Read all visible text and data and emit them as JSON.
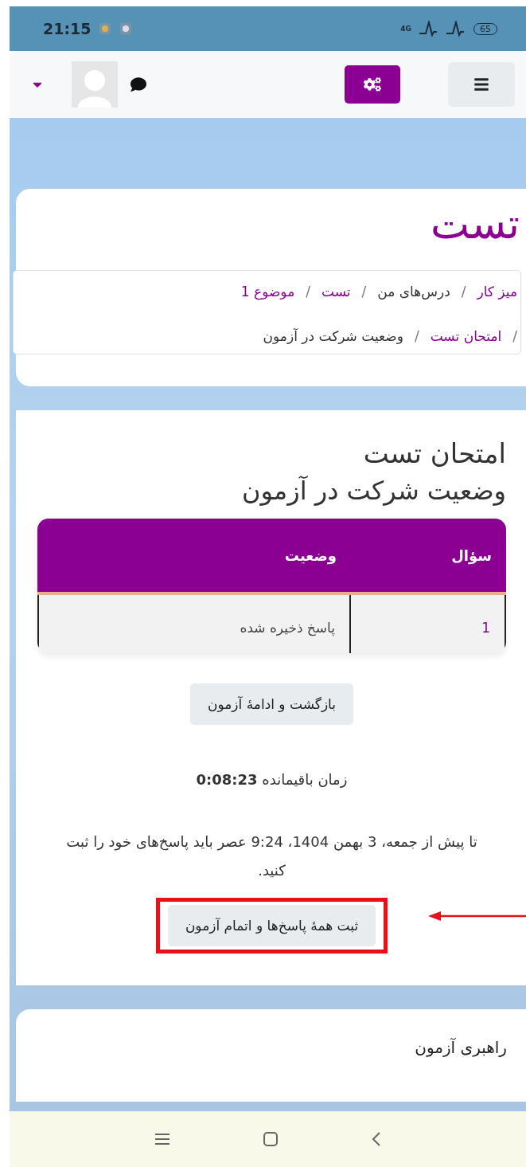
{
  "status_bar": {
    "time": "21:15",
    "network": "4G",
    "battery": "65"
  },
  "navbar": {
    "settings_button": {
      "selected": true
    }
  },
  "page_header": {
    "title": "تست",
    "breadcrumb": [
      {
        "kind": "link",
        "text": "میز کار"
      },
      {
        "kind": "separator",
        "text": "/"
      },
      {
        "kind": "plain",
        "text": "درس‌های من"
      },
      {
        "kind": "separator",
        "text": "/"
      },
      {
        "kind": "link",
        "text": "تست"
      },
      {
        "kind": "separator",
        "text": "/"
      },
      {
        "kind": "link",
        "text": "موضوع 1"
      },
      {
        "kind": "break"
      },
      {
        "kind": "separator",
        "text": "/"
      },
      {
        "kind": "link",
        "text": "امتحان تست"
      },
      {
        "kind": "separator",
        "text": "/"
      },
      {
        "kind": "plain",
        "text": "وضعیت شرکت در آزمون"
      }
    ]
  },
  "main": {
    "title": "امتحان تست",
    "subtitle": "وضعیت شرکت در آزمون",
    "table": {
      "columns": [
        "سؤال",
        "وضعیت"
      ],
      "rows": [
        {
          "question": "1",
          "status": "پاسخ ذخیره شده"
        }
      ]
    },
    "return_button": {
      "label": "بازگشت و ادامهٔ آزمون"
    },
    "time_left": "زمان باقیمانده **0:08:23**",
    "deadline": "تا پیش از جمعه، 3 بهمن 1404، 9:24 عصر باید پاسخ‌های خود را ثبت کنید.",
    "finish_button": {
      "label": "ثبت همهٔ پاسخ‌ها و اتمام آزمون",
      "highlighted": true
    }
  },
  "next_block": {
    "title": "راهبری آزمون"
  }
}
